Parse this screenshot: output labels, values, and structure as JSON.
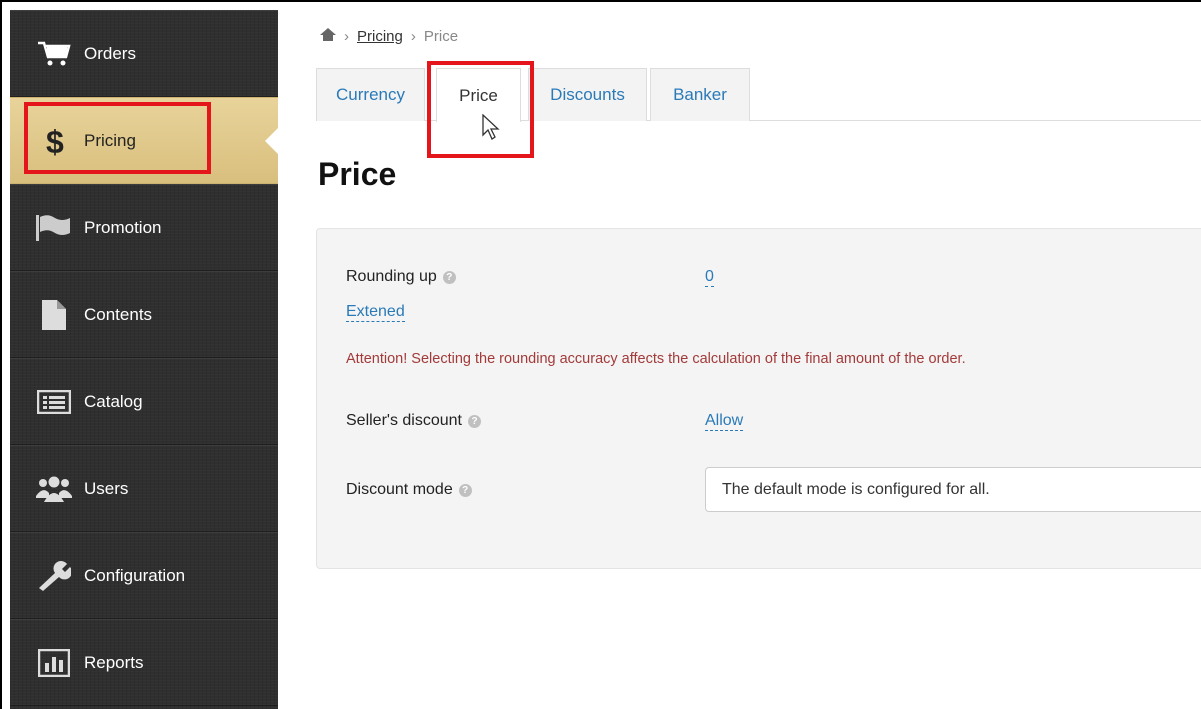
{
  "sidebar": {
    "items": [
      {
        "label": "Orders",
        "icon": "cart-icon"
      },
      {
        "label": "Pricing",
        "icon": "dollar-icon"
      },
      {
        "label": "Promotion",
        "icon": "flag-icon"
      },
      {
        "label": "Contents",
        "icon": "document-icon"
      },
      {
        "label": "Catalog",
        "icon": "list-icon"
      },
      {
        "label": "Users",
        "icon": "users-icon"
      },
      {
        "label": "Configuration",
        "icon": "wrench-icon"
      },
      {
        "label": "Reports",
        "icon": "bar-chart-icon"
      }
    ],
    "active": "Pricing"
  },
  "breadcrumb": {
    "home_icon": "home-icon",
    "section": "Pricing",
    "current": "Price"
  },
  "tabs": [
    {
      "label": "Currency"
    },
    {
      "label": "Price"
    },
    {
      "label": "Discounts"
    },
    {
      "label": "Banker"
    }
  ],
  "active_tab": "Price",
  "page": {
    "title": "Price"
  },
  "settings": {
    "rounding_label": "Rounding up",
    "rounding_value": "0",
    "extended_link": "Extened",
    "attention": "Attention! Selecting the rounding accuracy affects the calculation of the final amount of the order.",
    "seller_discount_label": "Seller's discount",
    "seller_discount_value": "Allow",
    "discount_mode_label": "Discount mode",
    "discount_mode_value": "The default mode is configured for all."
  },
  "help_icon": "?",
  "colors": {
    "highlight": "#e4161b",
    "link": "#2a7ab8",
    "warning": "#a33a3a",
    "active_nav": "#e3cc8e"
  }
}
